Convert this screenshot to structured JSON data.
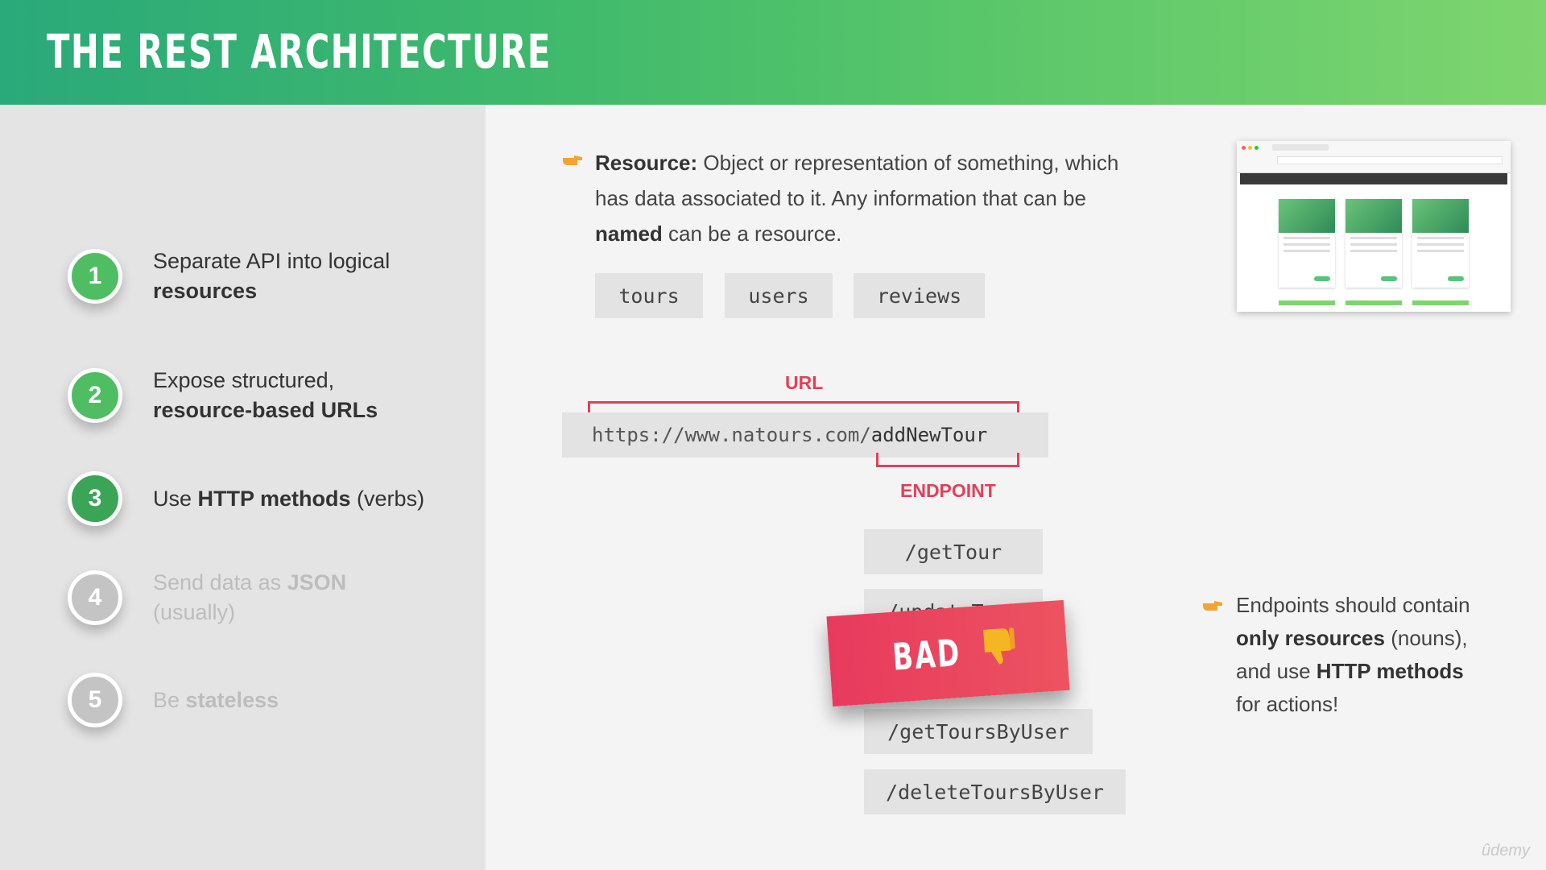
{
  "header": {
    "title": "THE REST ARCHITECTURE"
  },
  "steps": [
    {
      "number": "1",
      "line1_plain": "Separate API into logical",
      "line2_bold": "resources",
      "state": "active"
    },
    {
      "number": "2",
      "line1_plain": "Expose structured,",
      "line2_bold": "resource-based URLs",
      "state": "active"
    },
    {
      "number": "3",
      "text_before": "Use ",
      "text_bold": "HTTP methods",
      "text_after": " (verbs)",
      "state": "current"
    },
    {
      "number": "4",
      "line1_plain": "Send data as ",
      "line1_bold": "JSON",
      "line2_plain": "(usually)",
      "state": "inactive"
    },
    {
      "number": "5",
      "text_before": "Be ",
      "text_bold": "stateless",
      "state": "inactive"
    }
  ],
  "resource_definition": {
    "term": "Resource:",
    "line1": " Object or representation of something, which",
    "line2": "has data associated to it. Any information that can be",
    "bold_word": "named",
    "line3_rest": " can be a resource."
  },
  "resources": [
    "tours",
    "users",
    "reviews"
  ],
  "url": {
    "label": "URL",
    "base": "https://www.natours.com/",
    "endpoint": "addNewTour",
    "endpoint_label": "ENDPOINT"
  },
  "endpoints": [
    "/getTour",
    "/updateTour",
    "/getToursByUser",
    "/deleteToursByUser"
  ],
  "bad_stamp": {
    "label": "BAD"
  },
  "endpoints_note": {
    "line1": "Endpoints should contain",
    "bold1": "only resources",
    "after1": " (nouns),",
    "before2": "and use ",
    "bold2": "HTTP methods",
    "line4": "for actions!"
  },
  "watermark": "ûdemy",
  "colors": {
    "accent_green": "#4fbe63",
    "accent_red": "#e0415a",
    "inactive_gray": "#c4c4c4"
  },
  "icons": {
    "pointer": "pointing-hand-icon",
    "thumbs_down": "thumbs-down-icon"
  }
}
